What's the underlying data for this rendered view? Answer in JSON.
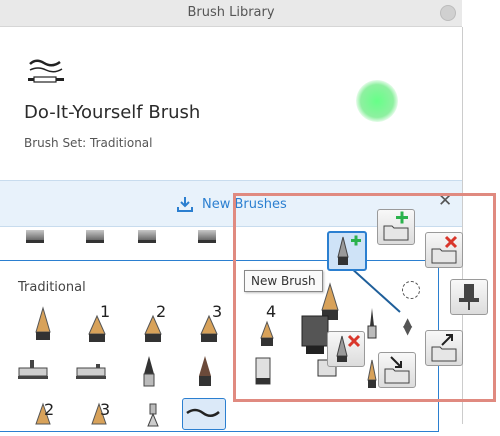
{
  "window": {
    "title": "Brush Library"
  },
  "brush": {
    "name": "Do-It-Yourself Brush",
    "set_label": "Brush Set: Traditional"
  },
  "new_brushes_bar": {
    "label": "New Brushes"
  },
  "grid": {
    "section_label": "Traditional",
    "numbers": [
      "1",
      "2",
      "3",
      "4",
      "2",
      "3"
    ]
  },
  "tooltip": {
    "text": "New Brush"
  },
  "colors": {
    "accent": "#2b7fd0",
    "preview": "#66ff88",
    "overlay_border": "#e08a80",
    "add_green": "#2bb24c",
    "delete_red": "#d9362b"
  },
  "icons": [
    "download-icon",
    "close-icon",
    "new-brush-icon",
    "new-set-icon",
    "delete-set-icon",
    "pin-icon",
    "delete-brush-icon",
    "import-icon",
    "export-icon",
    "dashed-circle-icon",
    "reorder-icon"
  ]
}
